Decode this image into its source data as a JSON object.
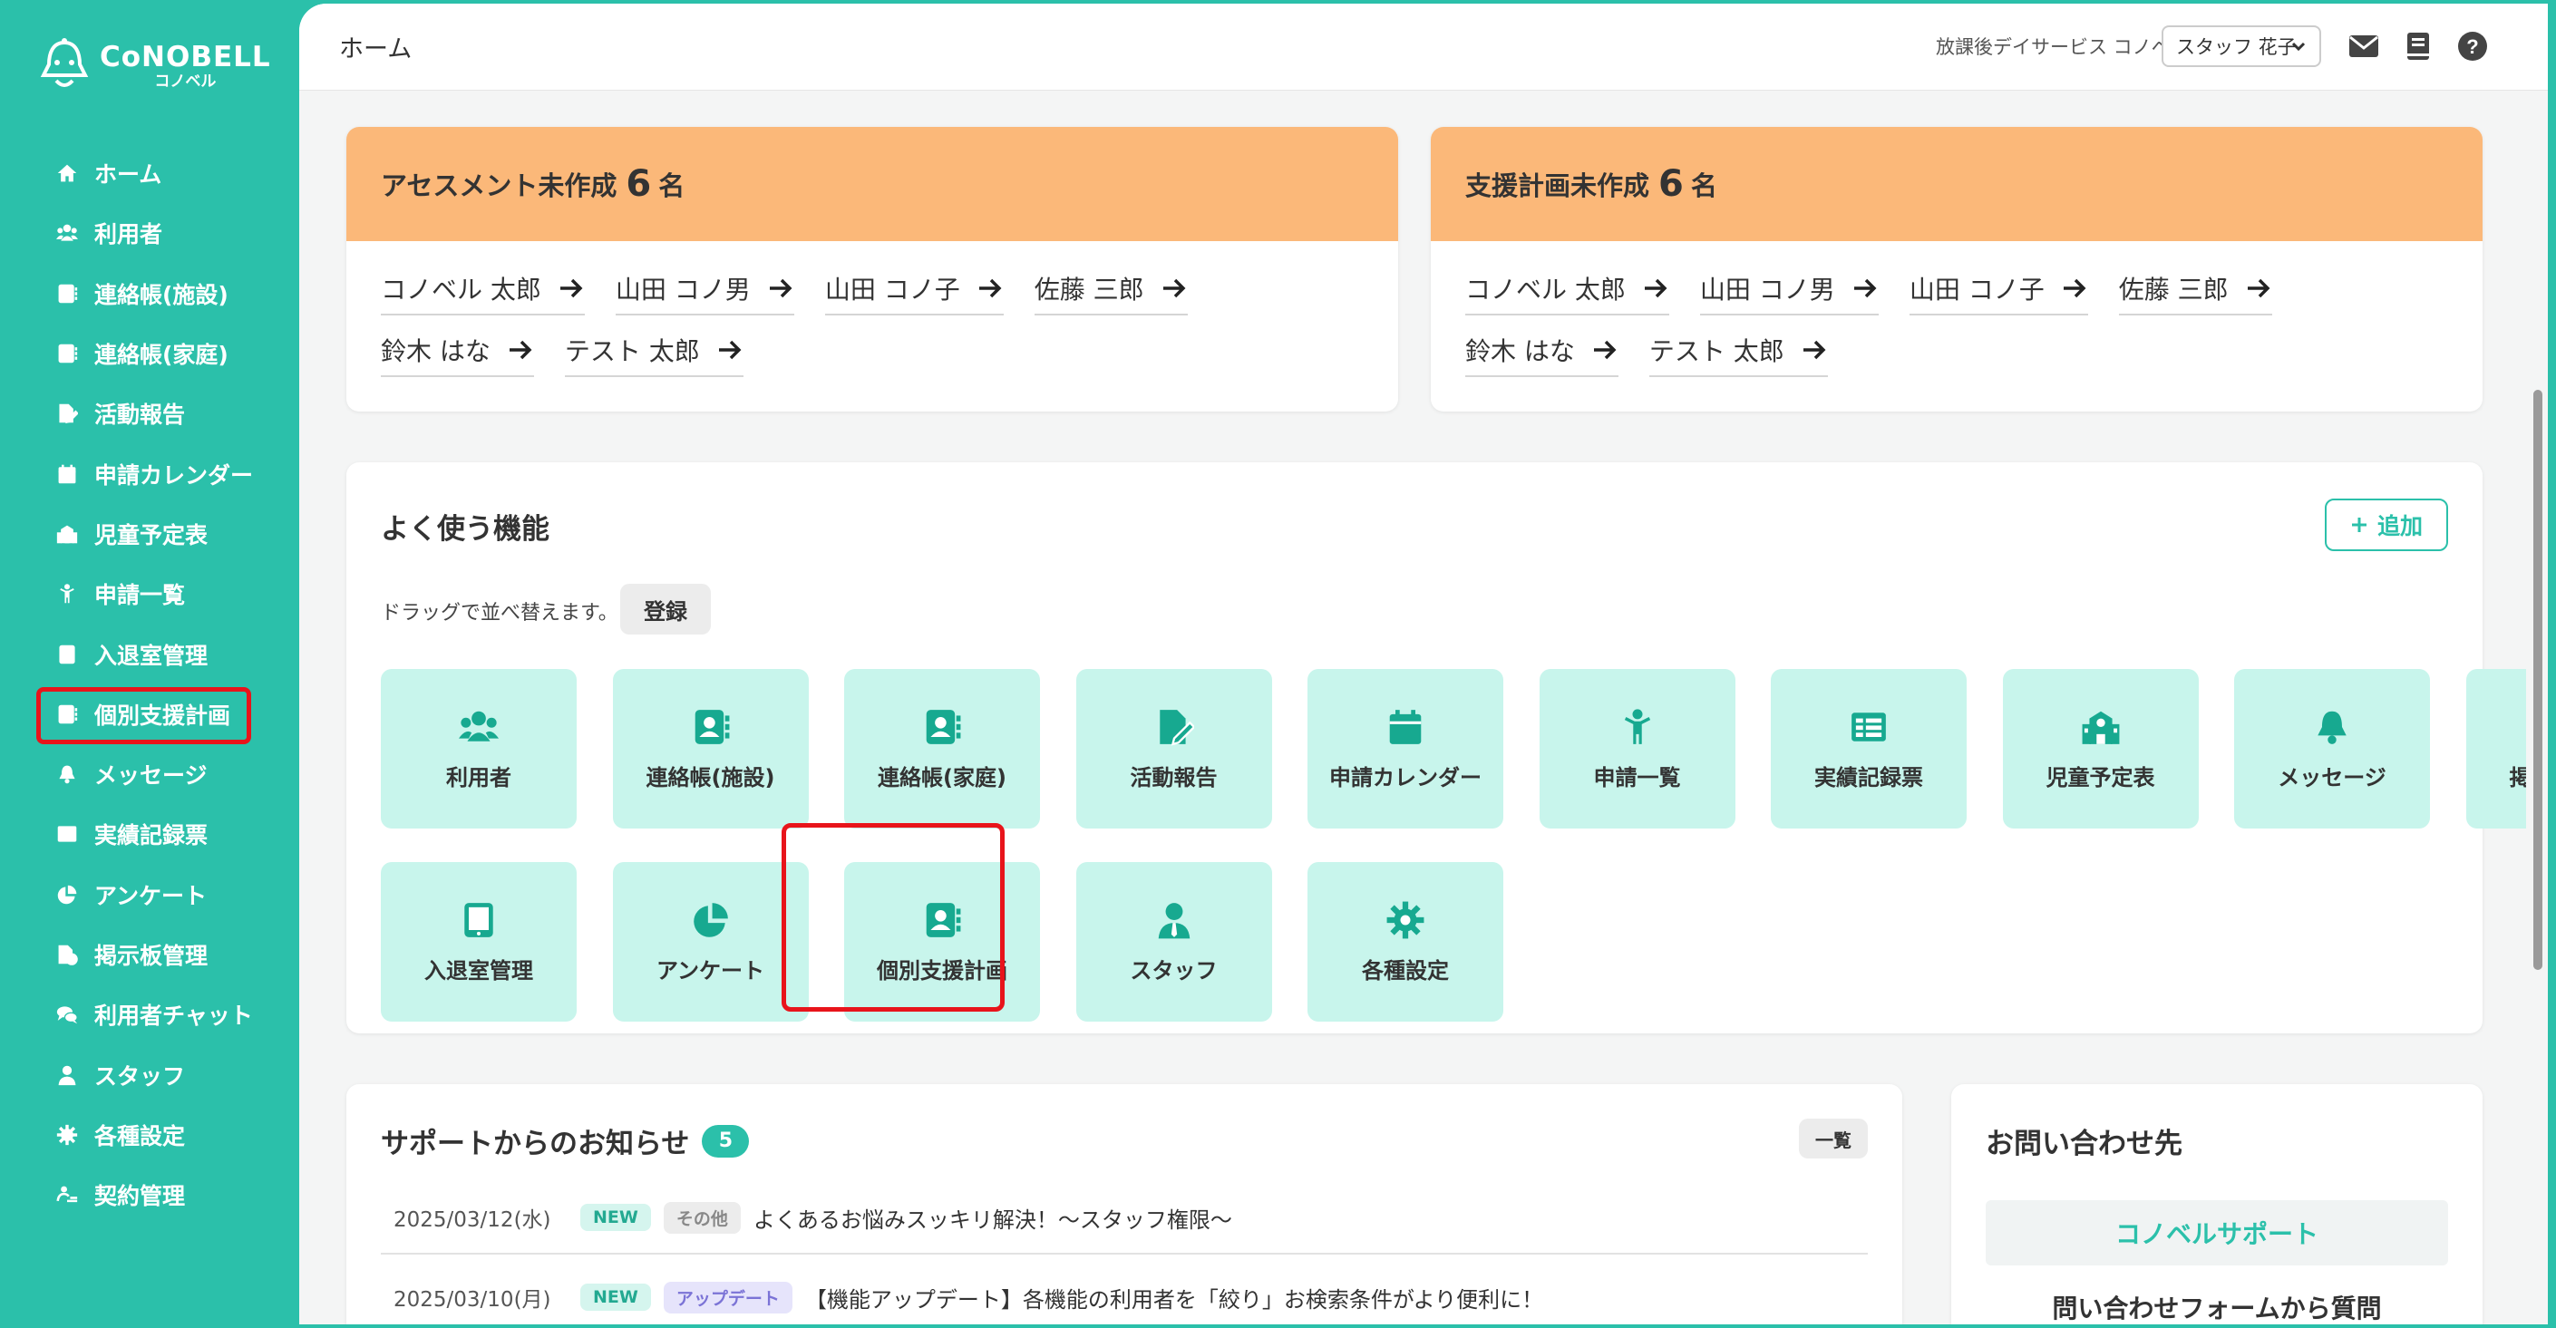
{
  "app": {
    "logo_main": "CoNOBELL",
    "logo_sub": "コノベル"
  },
  "sidebar": {
    "items": [
      {
        "label": "ホーム",
        "icon": "home-icon"
      },
      {
        "label": "利用者",
        "icon": "users-icon"
      },
      {
        "label": "連絡帳(施設)",
        "icon": "contact-book-icon"
      },
      {
        "label": "連絡帳(家庭)",
        "icon": "contact-book-icon"
      },
      {
        "label": "活動報告",
        "icon": "file-edit-icon"
      },
      {
        "label": "申請カレンダー",
        "icon": "calendar-icon"
      },
      {
        "label": "児童予定表",
        "icon": "school-icon"
      },
      {
        "label": "申請一覧",
        "icon": "child-icon"
      },
      {
        "label": "入退室管理",
        "icon": "tablet-icon"
      },
      {
        "label": "個別支援計画",
        "icon": "contact-book-icon"
      },
      {
        "label": "メッセージ",
        "icon": "bell-icon"
      },
      {
        "label": "実績記録票",
        "icon": "table-icon"
      },
      {
        "label": "アンケート",
        "icon": "pie-chart-icon"
      },
      {
        "label": "掲示板管理",
        "icon": "file-check-icon"
      },
      {
        "label": "利用者チャット",
        "icon": "chat-icon"
      },
      {
        "label": "スタッフ",
        "icon": "staff-icon"
      },
      {
        "label": "各種設定",
        "icon": "gear-icon"
      },
      {
        "label": "契約管理",
        "icon": "contract-icon"
      }
    ],
    "highlighted_index": 9
  },
  "topbar": {
    "page_title": "ホーム",
    "facility": "放課後デイサービス コノベル",
    "staff": "スタッフ 花子"
  },
  "assessment": {
    "title": "アセスメント未作成",
    "count": "6",
    "unit": "名",
    "names": [
      "コノベル 太郎",
      "山田 コノ男",
      "山田 コノ子",
      "佐藤 三郎",
      "鈴木 はな",
      "テスト 太郎"
    ]
  },
  "plan": {
    "title": "支援計画未作成",
    "count": "6",
    "unit": "名",
    "names": [
      "コノベル 太郎",
      "山田 コノ男",
      "山田 コノ子",
      "佐藤 三郎",
      "鈴木 はな",
      "テスト 太郎"
    ]
  },
  "favorites": {
    "title": "よく使う機能",
    "add_label": "追加",
    "drag_hint": "ドラッグで並べ替えます。",
    "register_label": "登録",
    "tiles": [
      {
        "label": "利用者",
        "icon": "users-icon"
      },
      {
        "label": "連絡帳(施設)",
        "icon": "contact-book-icon"
      },
      {
        "label": "連絡帳(家庭)",
        "icon": "contact-book-icon"
      },
      {
        "label": "活動報告",
        "icon": "file-edit-icon"
      },
      {
        "label": "申請カレンダー",
        "icon": "calendar-icon"
      },
      {
        "label": "申請一覧",
        "icon": "child-icon"
      },
      {
        "label": "実績記録票",
        "icon": "table-icon"
      },
      {
        "label": "児童予定表",
        "icon": "school-icon"
      },
      {
        "label": "メッセージ",
        "icon": "bell-icon"
      },
      {
        "label": "掲示板管理",
        "icon": "file-check-icon"
      },
      {
        "label": "入退室管理",
        "icon": "tablet-icon"
      },
      {
        "label": "アンケート",
        "icon": "pie-chart-icon"
      },
      {
        "label": "個別支援計画",
        "icon": "contact-book-icon"
      },
      {
        "label": "スタッフ",
        "icon": "staff-icon"
      },
      {
        "label": "各種設定",
        "icon": "gear-icon"
      }
    ]
  },
  "news": {
    "title": "サポートからのお知らせ",
    "count": "5",
    "list_label": "一覧",
    "items": [
      {
        "date": "2025/03/12(水)",
        "tags": [
          {
            "label": "NEW",
            "kind": "new"
          },
          {
            "label": "その他",
            "kind": "other"
          }
        ],
        "text": "よくあるお悩みスッキリ解決！～スタッフ権限～"
      },
      {
        "date": "2025/03/10(月)",
        "tags": [
          {
            "label": "NEW",
            "kind": "new"
          },
          {
            "label": "アップデート",
            "kind": "update"
          }
        ],
        "text": "【機能アップデート】各機能の利用者を「絞り」お検索条件がより便利に！"
      }
    ]
  },
  "contact": {
    "title": "お問い合わせ先",
    "support_label": "コノベルサポート",
    "form_label": "問い合わせフォームから質問"
  },
  "colors": {
    "brand": "#2bc0aa",
    "alert_header": "#fbb879",
    "tile_bg": "#c8f5ec",
    "highlight": "#e8141b"
  }
}
